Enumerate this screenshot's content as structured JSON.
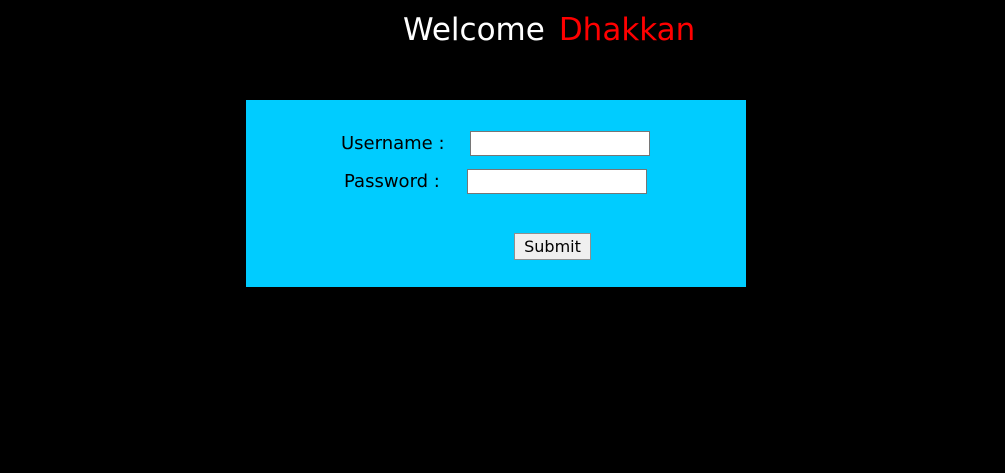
{
  "header": {
    "welcome": "Welcome",
    "name": "Dhakkan"
  },
  "form": {
    "username_label": "Username :",
    "username_value": "",
    "password_label": "Password :",
    "password_value": "",
    "submit_label": "Submit"
  },
  "colors": {
    "page_background": "#000000",
    "panel_background": "#00ccff",
    "name_color": "#ff0000",
    "welcome_color": "#ffffff"
  }
}
